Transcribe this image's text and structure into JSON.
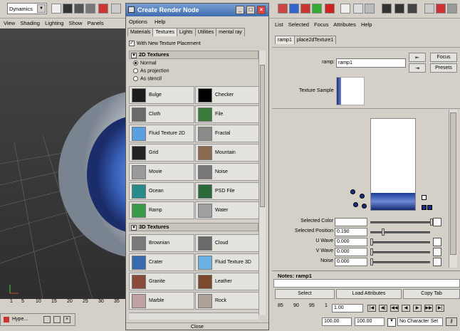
{
  "toolbar": {
    "mode": "Dynamics"
  },
  "viewport_menu": [
    "View",
    "Shading",
    "Lighting",
    "Show",
    "Panels"
  ],
  "timeline_ticks": [
    "1",
    "5",
    "10",
    "15",
    "20",
    "25",
    "30",
    "35"
  ],
  "hype_window": {
    "title": "Hype..."
  },
  "create_render_node": {
    "title": "Create Render Node",
    "menu": [
      "Options",
      "Help"
    ],
    "tabs": [
      "Materials",
      "Textures",
      "Lights",
      "Utilities",
      "mental ray"
    ],
    "active_tab": "Textures",
    "placement_checkbox": "With New Texture Placement",
    "section_2d": "2D Textures",
    "radio_options": [
      "Normal",
      "As projection",
      "As stencil"
    ],
    "nodes_2d": [
      {
        "label": "Bulge",
        "color": "#1c1c1c"
      },
      {
        "label": "Checker",
        "color": "#000000"
      },
      {
        "label": "Cloth",
        "color": "#6a6a6a"
      },
      {
        "label": "File",
        "color": "#3a7a3a"
      },
      {
        "label": "Fluid Texture 2D",
        "color": "#5aa0e0"
      },
      {
        "label": "Fractal",
        "color": "#8a8a8a"
      },
      {
        "label": "Grid",
        "color": "#222222"
      },
      {
        "label": "Mountain",
        "color": "#8a6a50"
      },
      {
        "label": "Movie",
        "color": "#9a9a9a"
      },
      {
        "label": "Noise",
        "color": "#777777"
      },
      {
        "label": "Ocean",
        "color": "#2a8a8a"
      },
      {
        "label": "PSD File",
        "color": "#2a6a3a"
      },
      {
        "label": "Ramp",
        "color": "#3a9a4a"
      },
      {
        "label": "Water",
        "color": "#a0a0a0"
      }
    ],
    "section_3d": "3D Textures",
    "nodes_3d": [
      {
        "label": "Brownian",
        "color": "#7a7a7a"
      },
      {
        "label": "Cloud",
        "color": "#6a6a6a"
      },
      {
        "label": "Crater",
        "color": "#3a6ab0"
      },
      {
        "label": "Fluid Texture 3D",
        "color": "#6ab0e0"
      },
      {
        "label": "Granite",
        "color": "#8a4a3a"
      },
      {
        "label": "Leather",
        "color": "#7a4a2a"
      },
      {
        "label": "Marble",
        "color": "#c0a0a0"
      },
      {
        "label": "Rock",
        "color": "#b0a09a"
      }
    ],
    "close_label": "Close"
  },
  "attribute_editor": {
    "menu": [
      "List",
      "Selected",
      "Focus",
      "Attributes",
      "Help"
    ],
    "tabs": [
      "ramp1",
      "place2dTexture1"
    ],
    "ramp_label": "ramp:",
    "ramp_value": "ramp1",
    "focus_label": "Focus",
    "presets_label": "Presets",
    "sample_label": "Texture Sample",
    "attributes": [
      {
        "label": "Selected Color",
        "value": ""
      },
      {
        "label": "Selected Position",
        "value": "0.190"
      },
      {
        "label": "U Wave",
        "value": "0.000"
      },
      {
        "label": "V Wave",
        "value": "0.000"
      },
      {
        "label": "Noise",
        "value": "0.000"
      }
    ],
    "notes_label": "Notes: ramp1",
    "select_label": "Select",
    "load_label": "Load Attributes",
    "copy_label": "Copy Tab"
  },
  "right_timeline": {
    "ticks": [
      "85",
      "90",
      "95",
      "1"
    ],
    "current_frame": "1.00",
    "range_start": "100.00",
    "range_end": "100.00",
    "character_set": "No Character Set"
  }
}
